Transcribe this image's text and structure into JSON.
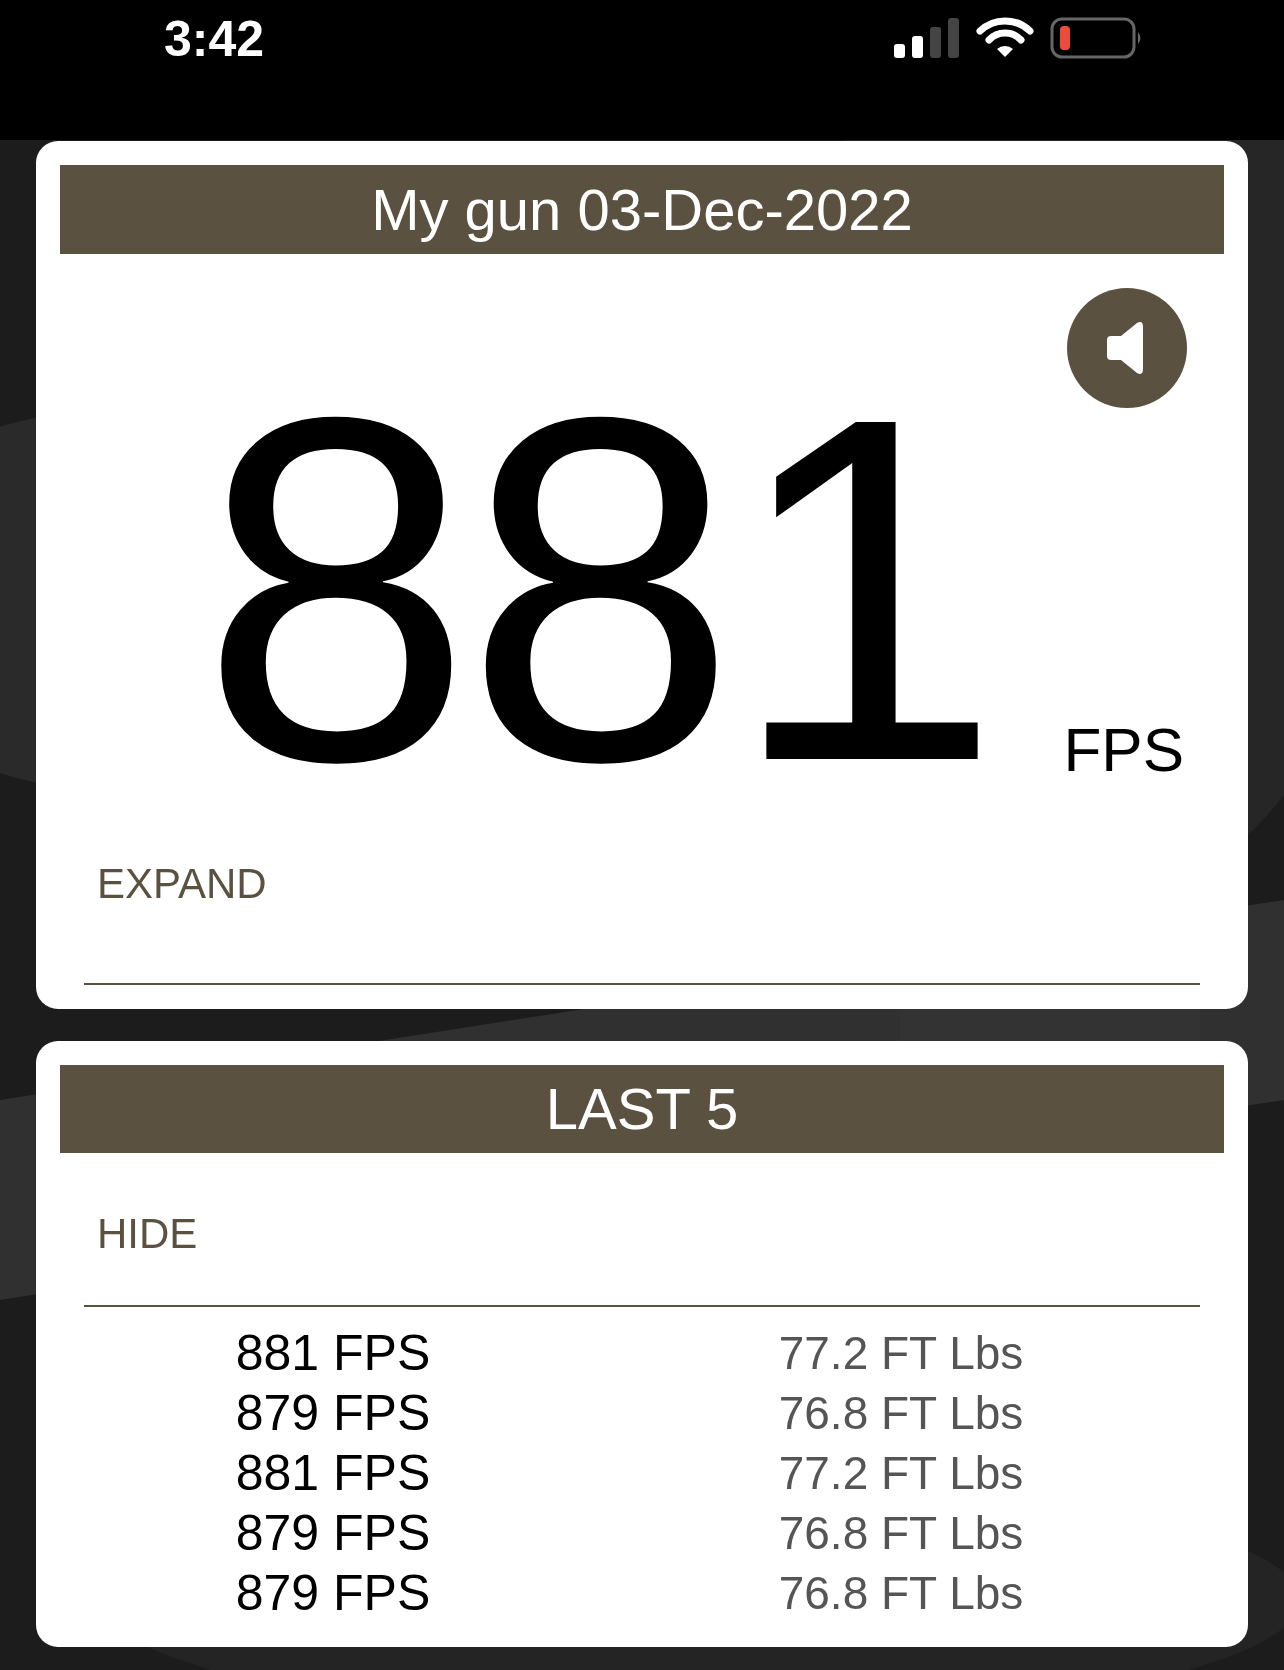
{
  "status_bar": {
    "time": "3:42"
  },
  "speed_card": {
    "title": "My gun 03-Dec-2022",
    "value": "881",
    "unit": "FPS",
    "toggle": "EXPAND"
  },
  "last_card": {
    "title": "LAST 5",
    "toggle": "HIDE",
    "rows": [
      {
        "speed": "881 FPS",
        "energy": "77.2 FT Lbs"
      },
      {
        "speed": "879 FPS",
        "energy": "76.8 FT Lbs"
      },
      {
        "speed": "881 FPS",
        "energy": "77.2 FT Lbs"
      },
      {
        "speed": "879 FPS",
        "energy": "76.8 FT Lbs"
      },
      {
        "speed": "879 FPS",
        "energy": "76.8 FT Lbs"
      }
    ]
  }
}
